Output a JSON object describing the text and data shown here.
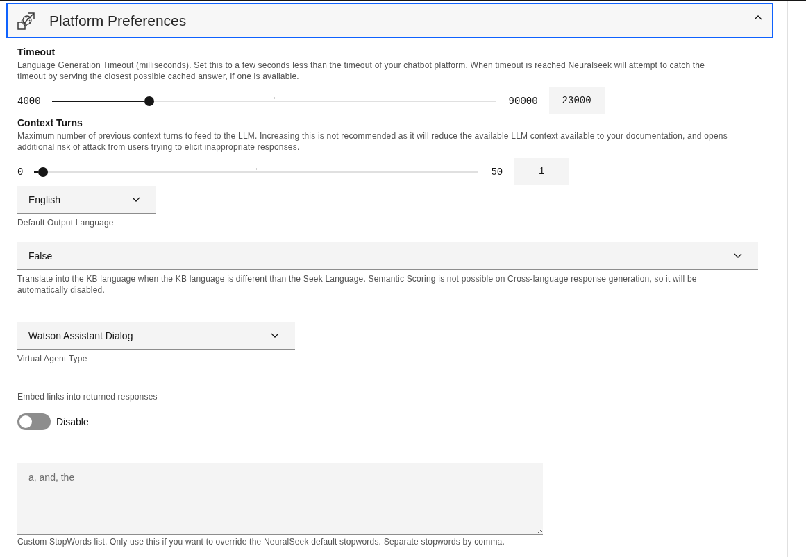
{
  "panel": {
    "title": "Platform Preferences",
    "expanded": true
  },
  "sliders": [
    {
      "title": "Timeout",
      "description": "Language Generation Timeout (milliseconds). Set this to a few seconds less than the timeout of your chatbot platform. When timeout is reached Neuralseek will attempt to catch the timeout by serving the closest possible cached answer, if one is available.",
      "min": "4000",
      "max": "90000",
      "level": 0.22,
      "value": "23000"
    },
    {
      "title": "Context Turns",
      "description": "Maximum number of previous context turns to feed to the LLM. Increasing this is not recommended as it will reduce the available LLM context available to your documentation, and opens additional risk of attack from users trying to elicit inappropriate responses.",
      "min": "0",
      "max": "50",
      "level": 0.02,
      "value": "1"
    }
  ],
  "selects": [
    {
      "value": "English",
      "helper": "Default Output Language"
    },
    {
      "value": "False",
      "helper": "Translate into the KB language when the KB language is different than the Seek Language. Semantic Scoring is not possible on Cross-language response generation, so it will be automatically disabled."
    },
    {
      "value": "Watson Assistant Dialog",
      "helper": "Virtual Agent Type"
    }
  ],
  "toggle": {
    "label": "Embed links into returned responses",
    "on": false,
    "state_text": "Disable"
  },
  "stopwords": {
    "placeholder": "a, and, the",
    "helper": "Custom StopWords list. Only use this if you want to override the NeuralSeek default stopwords. Separate stopwords by comma."
  }
}
